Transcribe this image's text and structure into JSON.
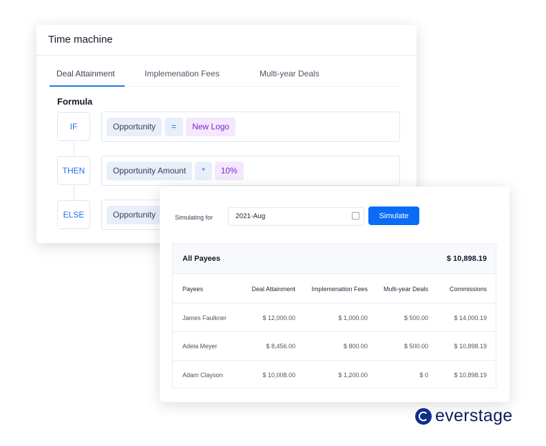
{
  "time_machine": {
    "title": "Time machine",
    "tabs": [
      {
        "label": "Deal Attainment",
        "active": true
      },
      {
        "label": "Implemenation Fees"
      },
      {
        "label": "Multi-year Deals"
      }
    ],
    "formula_label": "Formula",
    "rows": [
      {
        "keyword": "IF",
        "chips": [
          {
            "text": "Opportunity",
            "kind": "field"
          },
          {
            "text": "=",
            "kind": "operator"
          },
          {
            "text": "New Logo",
            "kind": "value"
          }
        ]
      },
      {
        "keyword": "THEN",
        "chips": [
          {
            "text": "Opportunity Amount",
            "kind": "field"
          },
          {
            "text": "*",
            "kind": "operator"
          },
          {
            "text": "10%",
            "kind": "value"
          }
        ]
      },
      {
        "keyword": "ELSE",
        "chips": [
          {
            "text": "Opportunity",
            "kind": "field"
          }
        ]
      }
    ]
  },
  "simulator": {
    "label": "Simulating for",
    "period": "2021-Aug",
    "calendar_icon": "calendar-icon",
    "button": "Simulate",
    "all_payees_label": "All Payees",
    "all_payees_total": "$ 10,898.19",
    "columns": [
      "Payees",
      "Deal Attainment",
      "Implemenation Fees",
      "Multi-year Deals",
      "Commissions"
    ],
    "rows": [
      [
        "James Faulkner",
        "$ 12,000.00",
        "$ 1,000.00",
        "$ 500.00",
        "$ 14,000.19"
      ],
      [
        "Adela Meyer",
        "$ 8,456.00",
        "$ 800.00",
        "$ 500.00",
        "$ 10,898.19"
      ],
      [
        "Adam Clayson",
        "$ 10,008.00",
        "$ 1,200.00",
        "$ 0",
        "$ 10,898.19"
      ]
    ]
  },
  "brand": {
    "name": "everstage",
    "color": "#0b2f8a"
  },
  "colors": {
    "accent": "#0a6cf5",
    "value_chip": "#7e22ce"
  }
}
